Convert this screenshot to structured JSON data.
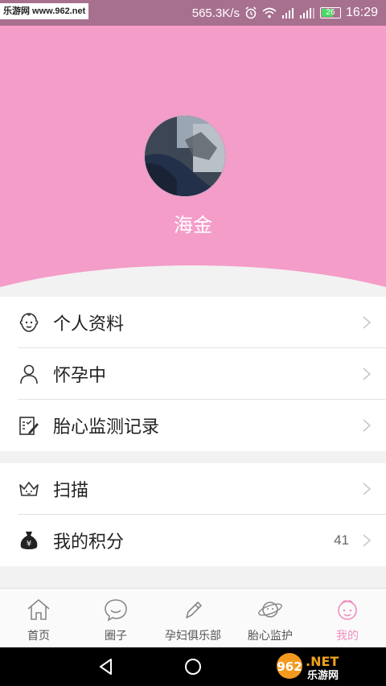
{
  "status_bar": {
    "watermark": "乐游网 www.962.net",
    "speed": "565.3K/s",
    "battery": "26",
    "time": "16:29"
  },
  "profile": {
    "username": "海金"
  },
  "menu": {
    "group1": [
      {
        "label": "个人资料",
        "icon": "baby-face-icon"
      },
      {
        "label": "怀孕中",
        "icon": "person-icon"
      },
      {
        "label": "胎心监测记录",
        "icon": "record-edit-icon"
      }
    ],
    "group2": [
      {
        "label": "扫描",
        "icon": "crown-scan-icon"
      },
      {
        "label": "我的积分",
        "icon": "money-bag-icon",
        "value": "41"
      }
    ]
  },
  "tabs": [
    {
      "label": "首页",
      "icon": "home-icon"
    },
    {
      "label": "圈子",
      "icon": "chat-bubble-icon"
    },
    {
      "label": "孕妇俱乐部",
      "icon": "pencil-icon"
    },
    {
      "label": "胎心监护",
      "icon": "planet-icon"
    },
    {
      "label": "我的",
      "icon": "baby-head-icon",
      "active": true
    }
  ],
  "logo": "962.NET 乐游网",
  "colors": {
    "header_pink": "#f49dc9",
    "active_tab": "#f08fc0",
    "status_bar": "#a8708f"
  }
}
